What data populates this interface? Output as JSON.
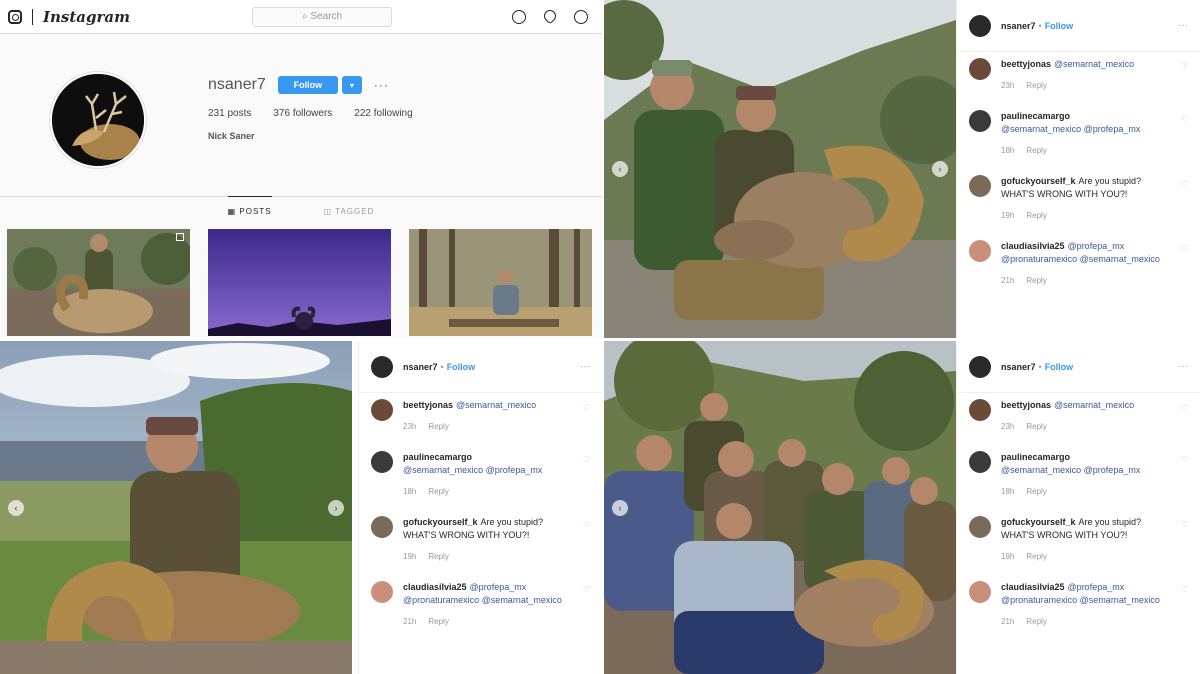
{
  "profile": {
    "nav": {
      "logo": "Instagram",
      "search_placeholder": "Search"
    },
    "username": "nsaner7",
    "follow_label": "Follow",
    "dropdown_label": "▾",
    "more_label": "···",
    "stats": {
      "posts": "231 posts",
      "followers": "376 followers",
      "following": "222 following"
    },
    "full_name": "Nick Saner",
    "tabs": [
      "POSTS",
      "TAGGED"
    ]
  },
  "posts": [
    {
      "username": "nsaner7",
      "follow_label": "Follow",
      "comments": [
        {
          "user": "beettyjonas",
          "text": "@semarnat_mexico",
          "time": "23h",
          "reply": "Reply",
          "avatar_color": "#6b4a3a"
        },
        {
          "user": "paulinecamargo",
          "text": "@semarnat_mexico @profepa_mx",
          "time": "18h",
          "reply": "Reply",
          "avatar_color": "#3a3a3a"
        },
        {
          "user": "gofuckyourself_k",
          "text": "Are you stupid? WHAT'S WRONG WITH YOU?!",
          "time": "19h",
          "reply": "Reply",
          "avatar_color": "#7a6a5a",
          "plain": true
        },
        {
          "user": "claudiasilvia25",
          "text": "@profepa_mx @pronaturamexico @semarnat_mexico",
          "time": "21h",
          "reply": "Reply",
          "avatar_color": "#c98f7a"
        }
      ]
    },
    {
      "username": "nsaner7",
      "follow_label": "Follow",
      "comments": [
        {
          "user": "beettyjonas",
          "text": "@semarnat_mexico",
          "time": "23h",
          "reply": "Reply",
          "avatar_color": "#6b4a3a"
        },
        {
          "user": "paulinecamargo",
          "text": "@semarnat_mexico @profepa_mx",
          "time": "18h",
          "reply": "Reply",
          "avatar_color": "#3a3a3a"
        },
        {
          "user": "gofuckyourself_k",
          "text": "Are you stupid? WHAT'S WRONG WITH YOU?!",
          "time": "19h",
          "reply": "Reply",
          "avatar_color": "#7a6a5a",
          "plain": true
        },
        {
          "user": "claudiasilvia25",
          "text": "@profepa_mx @pronaturamexico @semarnat_mexico",
          "time": "21h",
          "reply": "Reply",
          "avatar_color": "#c98f7a"
        }
      ]
    },
    {
      "username": "nsaner7",
      "follow_label": "Follow",
      "comments": [
        {
          "user": "beettyjonas",
          "text": "@semarnat_mexico",
          "time": "23h",
          "reply": "Reply",
          "avatar_color": "#6b4a3a"
        },
        {
          "user": "paulinecamargo",
          "text": "@semarnat_mexico @profepa_mx",
          "time": "18h",
          "reply": "Reply",
          "avatar_color": "#3a3a3a"
        },
        {
          "user": "gofuckyourself_k",
          "text": "Are you stupid? WHAT'S WRONG WITH YOU?!",
          "time": "19h",
          "reply": "Reply",
          "avatar_color": "#7a6a5a",
          "plain": true
        },
        {
          "user": "claudiasilvia25",
          "text": "@profepa_mx @pronaturamexico @semarnat_mexico",
          "time": "21h",
          "reply": "Reply",
          "avatar_color": "#c98f7a"
        }
      ]
    }
  ],
  "colors": {
    "accent": "#3897f0",
    "mention": "#3b5998"
  }
}
